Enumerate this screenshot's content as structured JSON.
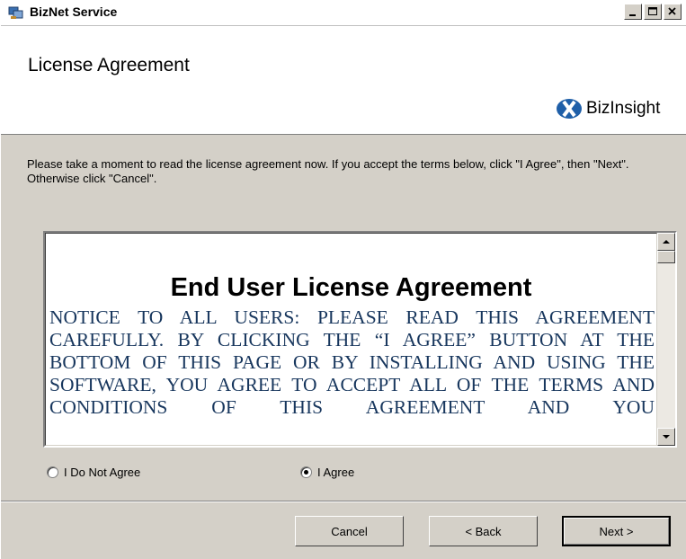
{
  "window": {
    "title": "BizNet Service"
  },
  "header": {
    "title": "License Agreement",
    "logo_text": "BizInsight"
  },
  "intro_text": "Please take a moment to read the license agreement now. If you accept the terms below, click \"I Agree\", then \"Next\". Otherwise click \"Cancel\".",
  "eula": {
    "heading": "End User License Agreement",
    "body": "NOTICE TO ALL USERS: PLEASE READ THIS AGREEMENT CAREFULLY. BY CLICKING THE “I AGREE” BUTTON AT THE BOTTOM OF THIS PAGE OR BY INSTALLING AND USING THE SOFTWARE, YOU AGREE TO ACCEPT ALL OF THE TERMS AND CONDITIONS OF THIS AGREEMENT AND YOU"
  },
  "options": {
    "disagree_label": "I Do Not Agree",
    "agree_label": "I Agree",
    "selected": "agree"
  },
  "buttons": {
    "cancel": "Cancel",
    "back": "< Back",
    "next": "Next >"
  },
  "colors": {
    "eula_text": "#17365d",
    "logo_blue": "#1f5fa8"
  }
}
